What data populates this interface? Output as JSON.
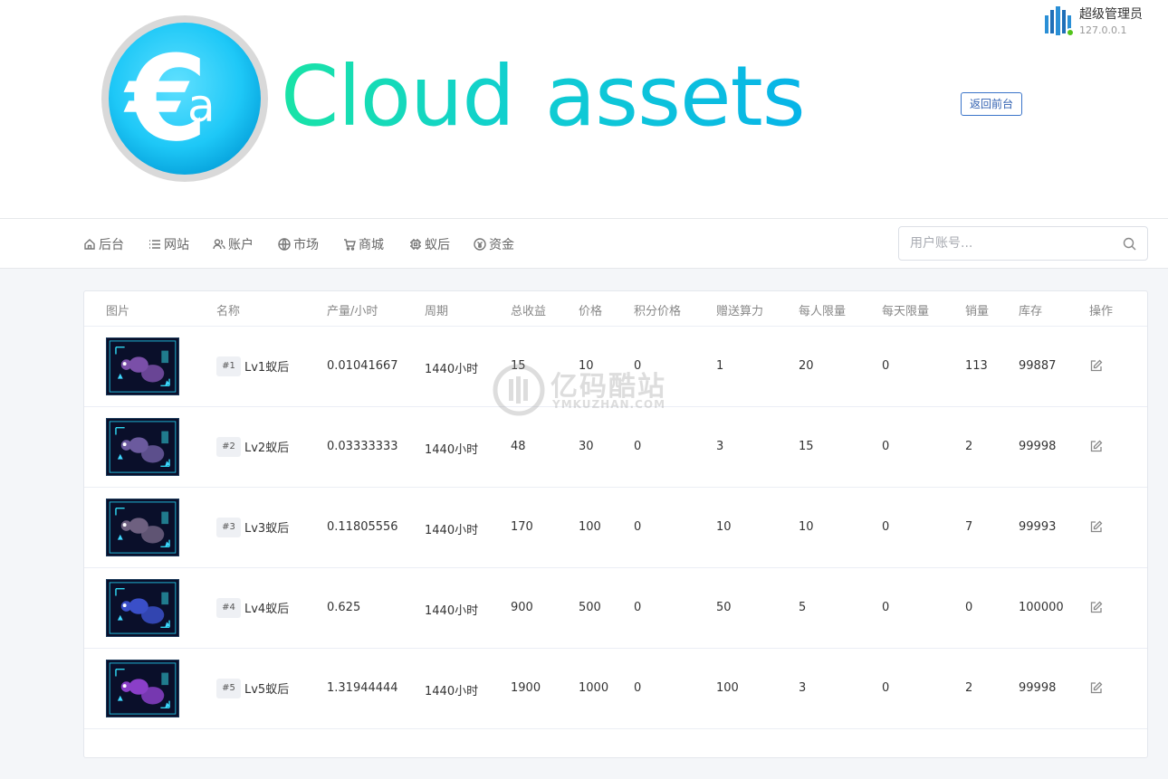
{
  "brand": {
    "logo_text_1": "Cloud",
    "logo_text_2": "assets",
    "coin_symbol": "€",
    "coin_letter": "a",
    "colors": {
      "gradient_start": "#19e3a6",
      "gradient_end": "#08b4e8",
      "coin": "#1ec8f7"
    }
  },
  "admin": {
    "name": "超级管理员",
    "ip": "127.0.0.1",
    "status_color": "#52c41a"
  },
  "header": {
    "return_button": "返回前台"
  },
  "nav": {
    "items": [
      {
        "label": "后台",
        "icon": "home-icon"
      },
      {
        "label": "网站",
        "icon": "list-icon"
      },
      {
        "label": "账户",
        "icon": "users-icon"
      },
      {
        "label": "市场",
        "icon": "globe-icon"
      },
      {
        "label": "商城",
        "icon": "cart-icon"
      },
      {
        "label": "蚁后",
        "icon": "chip-icon"
      },
      {
        "label": "资金",
        "icon": "coin-icon"
      }
    ],
    "search_placeholder": "用户账号..."
  },
  "table": {
    "headers": [
      "图片",
      "名称",
      "产量/小时",
      "周期",
      "总收益",
      "价格",
      "积分价格",
      "赠送算力",
      "每人限量",
      "每天限量",
      "销量",
      "库存",
      "操作"
    ],
    "rows": [
      {
        "id": "#1",
        "name": "Lv1蚁后",
        "output": "0.01041667",
        "period": "1440小时",
        "total": "15",
        "price": "10",
        "points_price": "0",
        "bonus_power": "1",
        "per_person": "20",
        "per_day": "0",
        "sales": "113",
        "stock": "99887"
      },
      {
        "id": "#2",
        "name": "Lv2蚁后",
        "output": "0.03333333",
        "period": "1440小时",
        "total": "48",
        "price": "30",
        "points_price": "0",
        "bonus_power": "3",
        "per_person": "15",
        "per_day": "0",
        "sales": "2",
        "stock": "99998"
      },
      {
        "id": "#3",
        "name": "Lv3蚁后",
        "output": "0.11805556",
        "period": "1440小时",
        "total": "170",
        "price": "100",
        "points_price": "0",
        "bonus_power": "10",
        "per_person": "10",
        "per_day": "0",
        "sales": "7",
        "stock": "99993"
      },
      {
        "id": "#4",
        "name": "Lv4蚁后",
        "output": "0.625",
        "period": "1440小时",
        "total": "900",
        "price": "500",
        "points_price": "0",
        "bonus_power": "50",
        "per_person": "5",
        "per_day": "0",
        "sales": "0",
        "stock": "100000"
      },
      {
        "id": "#5",
        "name": "Lv5蚁后",
        "output": "1.31944444",
        "period": "1440小时",
        "total": "1900",
        "price": "1000",
        "points_price": "0",
        "bonus_power": "100",
        "per_person": "3",
        "per_day": "0",
        "sales": "2",
        "stock": "99998"
      }
    ],
    "thumb_colors": [
      "#7a4fa8",
      "#6b5a9e",
      "#6e6080",
      "#3a4fc8",
      "#8a3fc8"
    ]
  },
  "watermark": {
    "cn": "亿码酷站",
    "en": "YMKUZHAN.COM"
  }
}
